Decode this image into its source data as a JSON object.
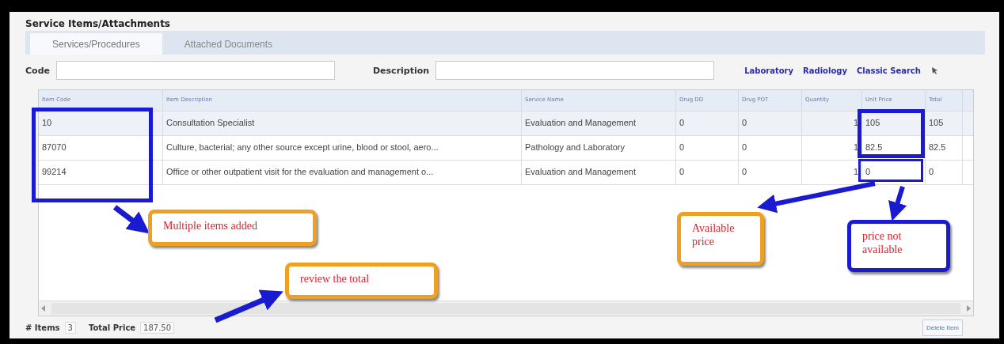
{
  "section_title": "Service Items/Attachments",
  "tabs": [
    {
      "label": "Services/Procedures",
      "selected": true
    },
    {
      "label": "Attached Documents",
      "selected": false
    }
  ],
  "filters": [
    {
      "label": "Code"
    },
    {
      "label": "Description"
    }
  ],
  "links": [
    "Laboratory",
    "Radiology",
    "Classic Search"
  ],
  "table": {
    "columns": [
      "Item Code",
      "Item Description",
      "Service Name",
      "Drug DD",
      "Drug POT",
      "Quantity",
      "Unit Price",
      "Total"
    ],
    "rows": [
      {
        "selected": true,
        "cells": [
          "10",
          "Consultation Specialist",
          "Evaluation and Management",
          "0",
          "0",
          "1",
          "105",
          "105"
        ]
      },
      {
        "selected": false,
        "cells": [
          "87070",
          "Culture, bacterial; any other source except urine, blood or stool, aero...",
          "Pathology and Laboratory",
          "0",
          "0",
          "1",
          "82.5",
          "82.5"
        ]
      },
      {
        "selected": false,
        "cells": [
          "99214",
          "Office or other outpatient visit for the evaluation and management o...",
          "Evaluation and Management",
          "0",
          "0",
          "1",
          "0",
          "0"
        ]
      }
    ]
  },
  "footer": {
    "items_label": "# Items",
    "items_count": "3",
    "total_label": "Total Price",
    "total_value": "187.50",
    "delete_button": "Delete Item"
  },
  "annotations": [
    {
      "text": "Multiple items added",
      "color": "#f0a020"
    },
    {
      "text": "Available price",
      "color": "#f0a020"
    },
    {
      "text": "price not available",
      "color": "#1a1ad0"
    },
    {
      "text": "review the total",
      "color": "#f0a020"
    }
  ]
}
